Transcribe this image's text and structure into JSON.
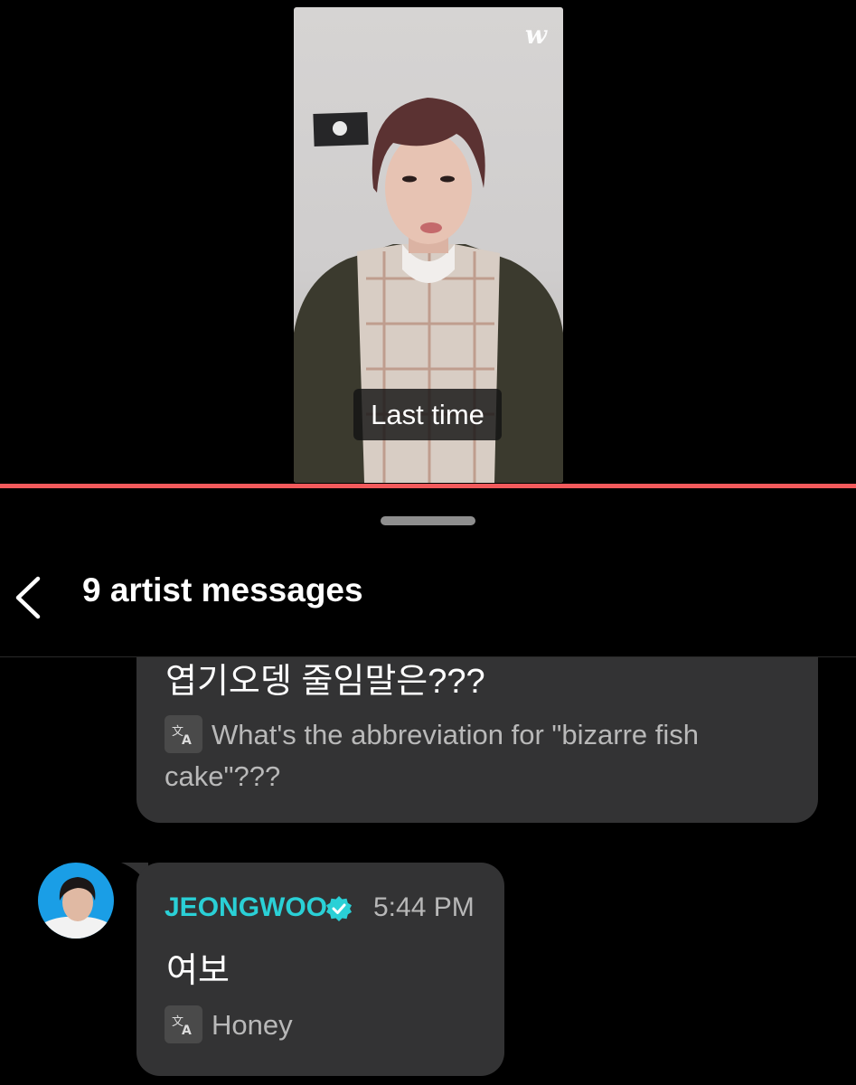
{
  "video": {
    "watermark": "w",
    "caption": "Last time"
  },
  "header": {
    "title": "9 artist messages",
    "back_icon": "chevron-left-icon"
  },
  "messages": [
    {
      "original": "엽기오뎅 줄임말은???",
      "translation": "What's the abbreviation for \"bizarre fish cake\"???",
      "translate_icon": "translate-icon"
    },
    {
      "author": "JEONGWOO",
      "verified_icon": "verified-badge-icon",
      "time": "5:44 PM",
      "original": "여보",
      "translation": "Honey",
      "translate_icon": "translate-icon"
    }
  ],
  "colors": {
    "progress": "#f35a5c",
    "author": "#2ad0d6",
    "bubble": "#333334"
  }
}
